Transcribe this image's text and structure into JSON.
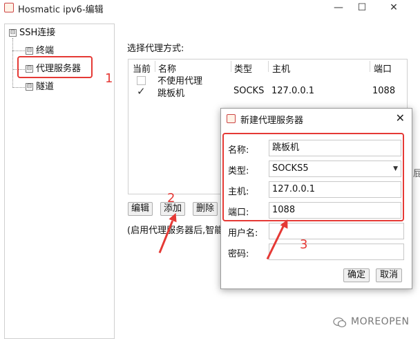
{
  "window": {
    "title": "Hosmatic ipv6-编辑",
    "minimize": "—",
    "maximize": "☐",
    "close": "✕"
  },
  "tree": {
    "root": "SSH连接",
    "items": [
      "终端",
      "代理服务器",
      "隧道"
    ],
    "expand_glyph": "⊟"
  },
  "main": {
    "section_title": "选择代理方式:",
    "columns": [
      "当前",
      "名称",
      "类型",
      "主机",
      "端口"
    ],
    "rows": [
      {
        "checked": false,
        "name": "不使用代理",
        "type": "",
        "host": "",
        "port": ""
      },
      {
        "checked": true,
        "check_glyph": "✓",
        "name": "跳板机",
        "type": "SOCKS",
        "host": "127.0.0.1",
        "port": "1088"
      }
    ],
    "buttons": {
      "edit": "编辑",
      "add": "添加",
      "delete": "删除"
    },
    "hint": "(启用代理服务器后,智能"
  },
  "dialog": {
    "title": "新建代理服务器",
    "close": "✕",
    "labels": {
      "name": "名称:",
      "type": "类型:",
      "host": "主机:",
      "port": "端口:",
      "user": "用户名:",
      "password": "密码:"
    },
    "values": {
      "name": "跳板机",
      "type": "SOCKS5",
      "host": "127.0.0.1",
      "port": "1088",
      "user": "",
      "password": ""
    },
    "ok": "确定",
    "cancel": "取消"
  },
  "annotations": {
    "n1": "1",
    "n2": "2",
    "n3": "3",
    "color": "#e53935"
  },
  "edge_text": "屁",
  "watermark": "MOREOPEN"
}
